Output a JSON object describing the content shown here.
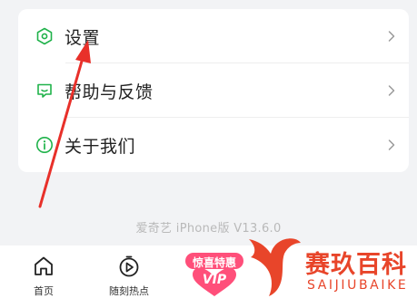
{
  "menu": {
    "items": [
      {
        "label": "设置",
        "icon": "settings-hexagon-icon"
      },
      {
        "label": "帮助与反馈",
        "icon": "feedback-chat-icon"
      },
      {
        "label": "关于我们",
        "icon": "info-icon"
      }
    ]
  },
  "version_text": "爱奇艺 iPhone版 V13.6.0",
  "tabbar": {
    "tabs": [
      {
        "label": "首页",
        "icon": "home-icon"
      },
      {
        "label": "随刻热点",
        "icon": "play-circle-icon"
      }
    ]
  },
  "promo": {
    "text": "惊喜特惠",
    "badge": "VIP"
  },
  "watermark": {
    "cn": "赛玖百科",
    "en": "SAIJIUBAIKE"
  },
  "colors": {
    "accent_green": "#1fb24a",
    "background": "#f2f3f5",
    "arrow_red": "#e8302a",
    "watermark_orange": "#e8452a",
    "promo_pink": "#ff4f7a"
  }
}
